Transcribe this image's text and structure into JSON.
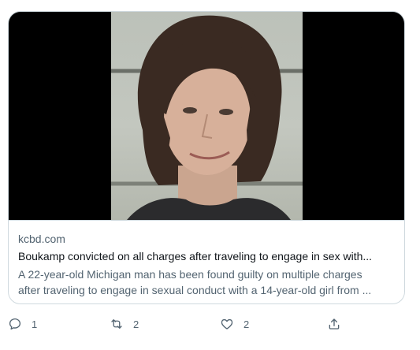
{
  "card": {
    "domain": "kcbd.com",
    "title": "Boukamp convicted on all charges after traveling to engage in sex with...",
    "description_line1": "A 22-year-old Michigan man has been found guilty on multiple charges",
    "description_line2": "after traveling to engage in sexual conduct with a 14-year-old girl from ...",
    "image_subject": "mugshot-photo"
  },
  "actions": {
    "reply": {
      "icon": "reply-icon",
      "count": "1"
    },
    "retweet": {
      "icon": "retweet-icon",
      "count": "2"
    },
    "like": {
      "icon": "heart-icon",
      "count": "2"
    },
    "share": {
      "icon": "share-icon"
    }
  },
  "colors": {
    "border": "#cfd9de",
    "secondary_text": "#536471",
    "primary_text": "#0f1419"
  }
}
